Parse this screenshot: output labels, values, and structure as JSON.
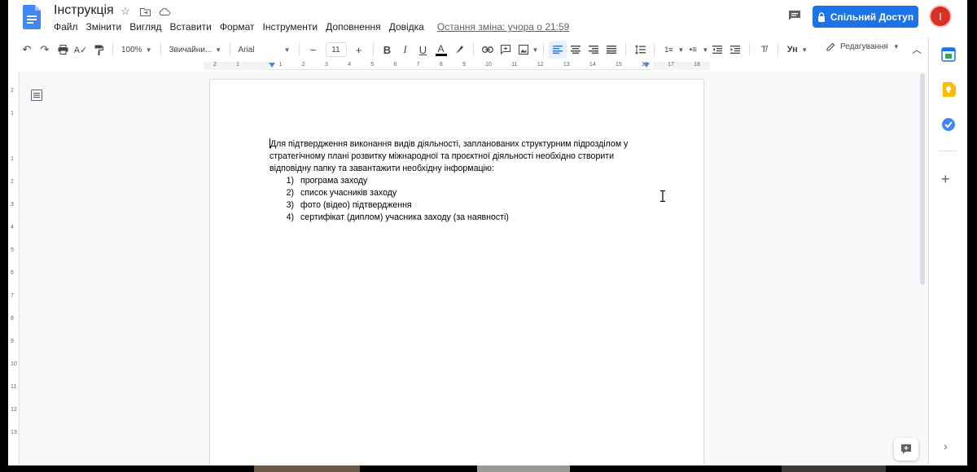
{
  "header": {
    "title": "Інструкція",
    "menu": [
      "Файл",
      "Змінити",
      "Вигляд",
      "Вставити",
      "Формат",
      "Інструменти",
      "Доповнення",
      "Довідка"
    ],
    "last_edit": "Остання зміна: учора о 21:59",
    "share_label": "Спільний Доступ",
    "avatar_letter": "І"
  },
  "toolbar": {
    "zoom": "100%",
    "style": "Звичайни...",
    "font": "Arial",
    "font_size": "11",
    "mode": "Редагування"
  },
  "ruler": {
    "marks": [
      "2",
      "1",
      "",
      "1",
      "2",
      "3",
      "4",
      "5",
      "6",
      "7",
      "8",
      "9",
      "10",
      "11",
      "12",
      "13",
      "14",
      "15",
      "16",
      "17",
      "18"
    ]
  },
  "document": {
    "paragraph": "Для підтвердження виконання видів діяльності, запланованих структурним підрозділом у стратегічному плані розвитку міжнародної та проєктної діяльності необхідно створити відповідну папку та завантажити необхідну  інформацію:",
    "list": [
      {
        "num": "1)",
        "text": "програма заходу"
      },
      {
        "num": "2)",
        "text": "список учасників заходу"
      },
      {
        "num": "3)",
        "text": "фото (відео) підтвердження"
      },
      {
        "num": "4)",
        "text": "сертифікат (диплом) учасника заходу (за наявності)"
      }
    ]
  },
  "colors": {
    "accent": "#1a73e8",
    "avatar": "#d93025",
    "calendar": "#1a73e8",
    "keep": "#fbbc04",
    "tasks": "#4285f4"
  }
}
